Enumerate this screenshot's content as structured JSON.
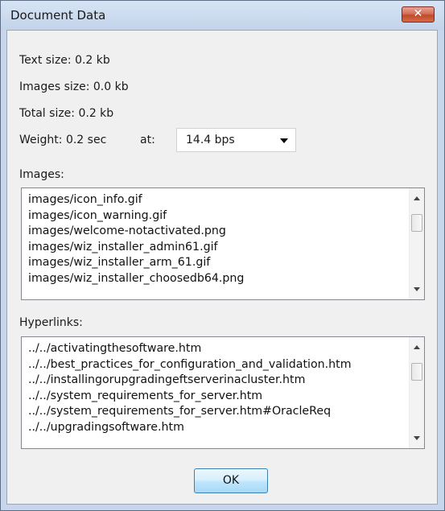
{
  "window": {
    "title": "Document Data",
    "close_glyph": "✕"
  },
  "stats": {
    "text_size": "Text size: 0.2 kb",
    "images_size": "Images size: 0.0 kb",
    "total_size": "Total size: 0.2 kb",
    "weight": "Weight: 0.2 sec",
    "at_label": "at:"
  },
  "speed_select": {
    "selected": "14.4 bps"
  },
  "images": {
    "label": "Images:",
    "items": [
      "images/icon_info.gif",
      "images/icon_warning.gif",
      "images/welcome-notactivated.png",
      "images/wiz_installer_admin61.gif",
      "images/wiz_installer_arm_61.gif",
      "images/wiz_installer_choosedb64.png"
    ]
  },
  "hyperlinks": {
    "label": "Hyperlinks:",
    "items": [
      "../../activatingthesoftware.htm",
      "../../best_practices_for_configuration_and_validation.htm",
      "../../installingorupgradingeftserverinacluster.htm",
      "../../system_requirements_for_server.htm",
      "../../system_requirements_for_server.htm#OracleReq",
      "../../upgradingsoftware.htm"
    ]
  },
  "buttons": {
    "ok": "OK"
  }
}
